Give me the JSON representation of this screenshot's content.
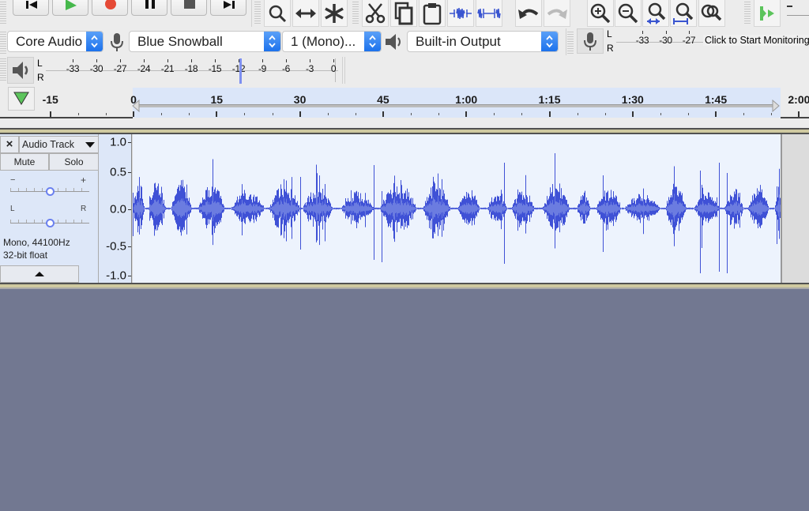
{
  "transport": {
    "buttons": [
      {
        "name": "skip-to-start",
        "icon": "skip-start-icon"
      },
      {
        "name": "play",
        "icon": "play-icon"
      },
      {
        "name": "record",
        "icon": "record-icon"
      },
      {
        "name": "pause",
        "icon": "pause-icon"
      },
      {
        "name": "stop",
        "icon": "stop-icon"
      },
      {
        "name": "skip-to-end",
        "icon": "skip-end-icon"
      }
    ]
  },
  "tools": {
    "buttons": [
      {
        "name": "zoom-tool",
        "icon": "magnifier-icon"
      },
      {
        "name": "timeshift-tool",
        "icon": "double-arrow-icon"
      },
      {
        "name": "multi-tool",
        "icon": "asterisk-icon"
      },
      {
        "name": "cut",
        "icon": "scissors-icon"
      },
      {
        "name": "copy",
        "icon": "copy-icon"
      },
      {
        "name": "paste",
        "icon": "clipboard-icon"
      },
      {
        "name": "trim",
        "icon": "trim-audio-icon"
      },
      {
        "name": "silence",
        "icon": "silence-audio-icon"
      },
      {
        "name": "undo",
        "icon": "undo-icon"
      },
      {
        "name": "redo",
        "icon": "redo-icon"
      },
      {
        "name": "zoom-in",
        "icon": "zoom-in-icon"
      },
      {
        "name": "zoom-out",
        "icon": "zoom-out-icon"
      },
      {
        "name": "fit-selection",
        "icon": "zoom-selection-icon"
      },
      {
        "name": "fit-project",
        "icon": "zoom-fit-icon"
      },
      {
        "name": "zoom-toggle",
        "icon": "zoom-toggle-icon"
      },
      {
        "name": "play-at-speed",
        "icon": "play-at-speed-icon"
      }
    ]
  },
  "device": {
    "host": "Core Audio",
    "recording_device": "Blue Snowball",
    "channels": "1 (Mono)...",
    "playback_device": "Built-in Output"
  },
  "record_meter": {
    "channels": [
      "L",
      "R"
    ],
    "scale": [
      "-33",
      "-30",
      "-27"
    ],
    "prompt": "Click to Start Monitoring"
  },
  "playback_meter": {
    "channels": [
      "L",
      "R"
    ],
    "scale": [
      "-33",
      "-30",
      "-27",
      "-24",
      "-21",
      "-18",
      "-15",
      "-12",
      "-9",
      "-6",
      "-3",
      "0"
    ],
    "level_marker": "-12"
  },
  "timeline": {
    "labels": [
      "-15",
      "0",
      "15",
      "30",
      "45",
      "1:00",
      "1:15",
      "1:30",
      "1:45",
      "2:00"
    ],
    "selection_start": "0",
    "selection_end": "1:57"
  },
  "track": {
    "name": "Audio Track",
    "mute_label": "Mute",
    "solo_label": "Solo",
    "gain_minus": "−",
    "gain_plus": "+",
    "pan_left": "L",
    "pan_right": "R",
    "gain_value": 0.5,
    "pan_value": 0.5,
    "format_line1": "Mono, 44100Hz",
    "format_line2": "32-bit float",
    "amplitude_labels": [
      "1.0",
      "0.5-",
      "0.0-",
      "-0.5-",
      "-1.0"
    ],
    "wave_color": "#3f51d6",
    "wave_rms_color": "#6b7ce0"
  }
}
